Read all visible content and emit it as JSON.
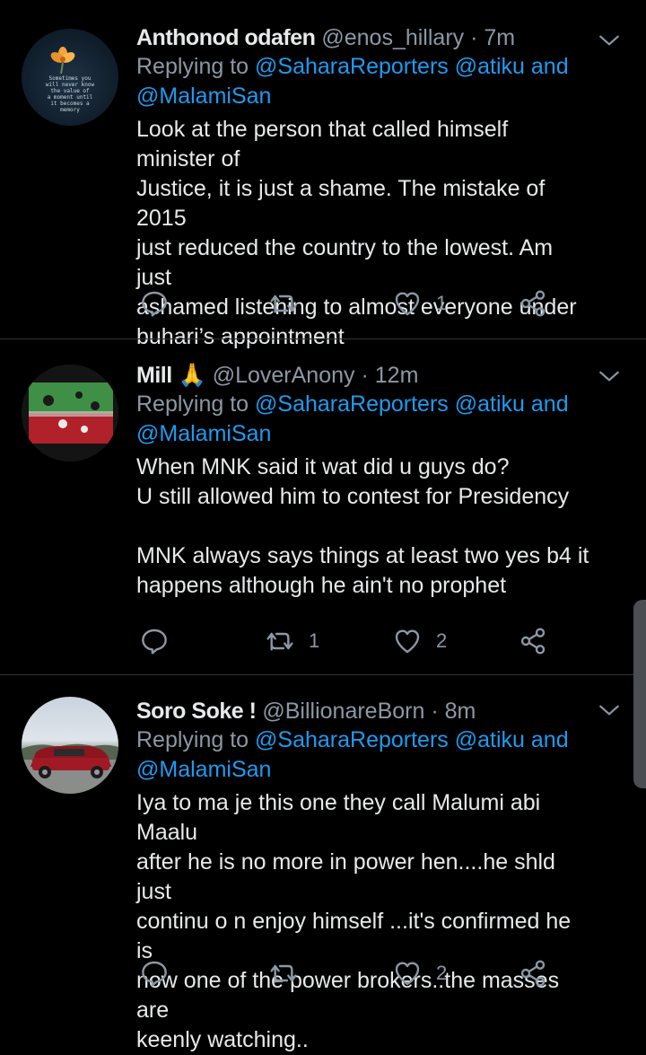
{
  "tweets": [
    {
      "name": "Anthonod odafen",
      "handle": "@enos_hillary",
      "time": "7m",
      "replying_prefix": "Replying to ",
      "mention1": "@SaharaReporters",
      "mention2": "@atiku",
      "and": "and",
      "mention3": "@MalamiSan",
      "body": "Look at the person that called himself minister of\nJustice, it is just a shame. The mistake of 2015\njust reduced the country to the lowest. Am just\nashamed listening to almost everyone under\nbuhari’s appointment",
      "avatar_text": "Sometimes you\nwill never know\nthe value of\na moment until\nit becomes a\nmemory",
      "retweets": "",
      "likes": "1"
    },
    {
      "name": "Mill",
      "emoji": "🙏",
      "handle": "@LoverAnony",
      "time": "12m",
      "replying_prefix": "Replying to ",
      "mention1": "@SaharaReporters",
      "mention2": "@atiku",
      "and": "and",
      "mention3": "@MalamiSan",
      "body": "When MNK said it wat did u guys do?\nU still allowed him to contest for Presidency\n\nMNK always says things at least two yes b4 it\nhappens although he ain't no prophet",
      "retweets": "1",
      "likes": "2"
    },
    {
      "name": "Soro Soke !",
      "handle": "@BillionareBorn",
      "time": "8m",
      "replying_prefix": "Replying to ",
      "mention1": "@SaharaReporters",
      "mention2": "@atiku",
      "and": "and",
      "mention3": "@MalamiSan",
      "body": "Iya to ma je this one they call Malumi abi Maalu\nafter he is no more in power hen....he shld just\ncontinu o n enjoy himself ...it's confirmed he is\nnow one of the power brokers..the masses are\nkeenly watching..",
      "retweets": "",
      "likes": "2"
    }
  ],
  "separator_dot": "·",
  "colors": {
    "background": "#000000",
    "text": "#e7e9ea",
    "muted": "#8b98a5",
    "link": "#1d9bf0"
  }
}
